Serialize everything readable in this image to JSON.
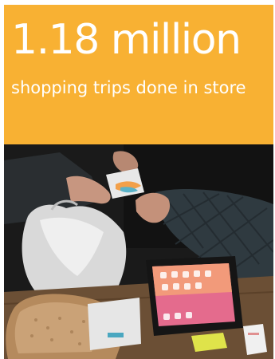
{
  "colors": {
    "banner_background": "#f8b133",
    "headline_text": "#ffffff"
  },
  "stat": {
    "value": "1.18 million",
    "description": "shopping trips done in store"
  },
  "photo": {
    "icon": "checkout-transaction-photo"
  }
}
